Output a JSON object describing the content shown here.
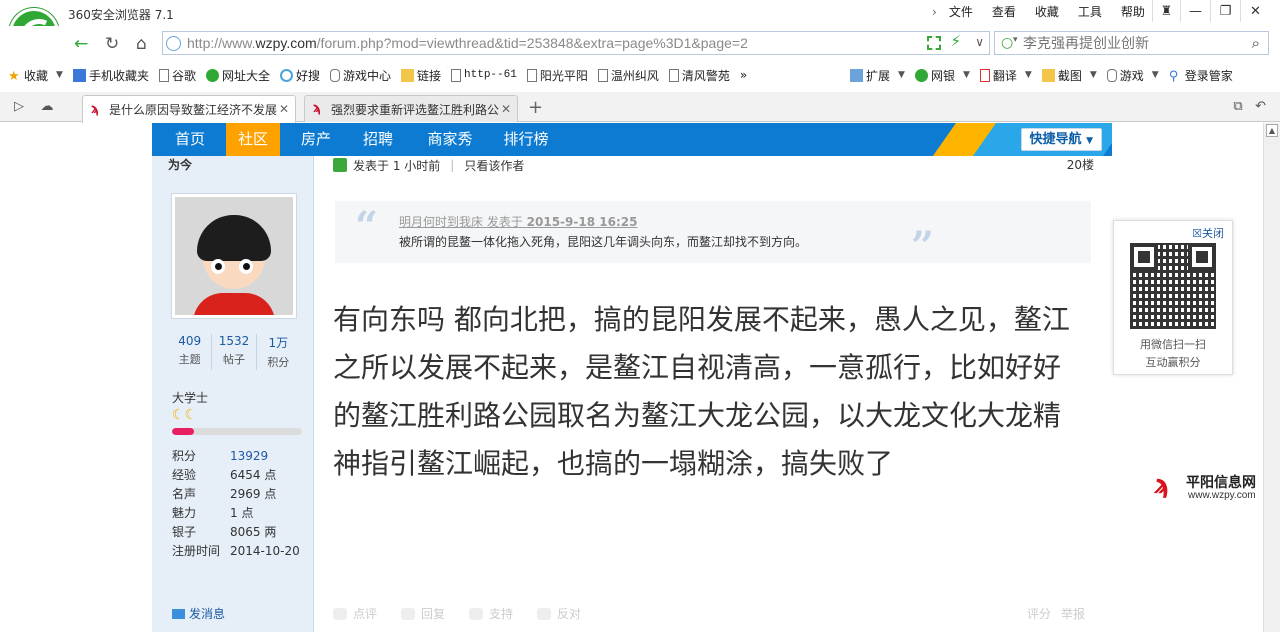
{
  "browser": {
    "app_title": "360安全浏览器 7.1",
    "menu": [
      "文件",
      "查看",
      "收藏",
      "工具",
      "帮助"
    ],
    "url_prefix": "http://www.",
    "url_domain": "wzpy.com",
    "url_path": "/forum.php?mod=viewthread&tid=253848&extra=page%3D1&page=2",
    "search_placeholder": "李克强再提创业创新",
    "bookmarks": [
      "收藏",
      "手机收藏夹",
      "谷歌",
      "网址大全",
      "好搜",
      "游戏中心",
      "链接",
      "http--61",
      "阳光平阳",
      "温州纠风",
      "清风警苑"
    ],
    "tools": [
      "扩展",
      "网银",
      "翻译",
      "截图",
      "游戏",
      "登录管家"
    ],
    "tabs": [
      {
        "title": "是什么原因导致鳌江经济不发展"
      },
      {
        "title": "强烈要求重新评选鳌江胜利路公"
      }
    ]
  },
  "site": {
    "nav": [
      "首页",
      "社区",
      "房产",
      "招聘",
      "商家秀",
      "排行榜"
    ],
    "active_nav": "社区",
    "quick_nav": "快捷导航"
  },
  "user": {
    "name": "为今",
    "stats": [
      {
        "num": "409",
        "label": "主题"
      },
      {
        "num": "1532",
        "label": "帖子"
      },
      {
        "num": "1万",
        "label": "积分"
      }
    ],
    "rank": "大学士",
    "rank_progress": 0.17,
    "profile": [
      {
        "k": "积分",
        "v": "13929",
        "link": true
      },
      {
        "k": "经验",
        "v": "6454 点"
      },
      {
        "k": "名声",
        "v": "2969 点"
      },
      {
        "k": "魅力",
        "v": "1 点"
      },
      {
        "k": "银子",
        "v": "8065 两"
      },
      {
        "k": "注册时间",
        "v": "2014-10-20"
      }
    ],
    "send_message": "发消息"
  },
  "post": {
    "posted": "发表于 1 小时前",
    "author_only": "只看该作者",
    "floor": "20楼",
    "quote_author": "明月何时到我床 发表于",
    "quote_time": "2015-9-18 16:25",
    "quote_text": "被所谓的昆鳌一体化拖入死角，昆阳这几年调头向东，而鳌江却找不到方向。",
    "content": "有向东吗 都向北把，搞的昆阳发展不起来，愚人之见，鳌江之所以发展不起来，是鳌江自视清高，一意孤行，比如好好的鳌江胜利路公园取名为鳌江大龙公园，以大龙文化大龙精神指引鳌江崛起，也搞的一塌糊涂，搞失败了",
    "actions": [
      "点评",
      "回复",
      "支持",
      "反对"
    ],
    "actions_right": [
      "评分",
      "举报"
    ]
  },
  "qr_popup": {
    "close": "关闭",
    "line1": "用微信扫一扫",
    "line2": "互动赢积分"
  },
  "watermark": {
    "name": "平阳信息网",
    "site": "www.wzpy.com"
  }
}
